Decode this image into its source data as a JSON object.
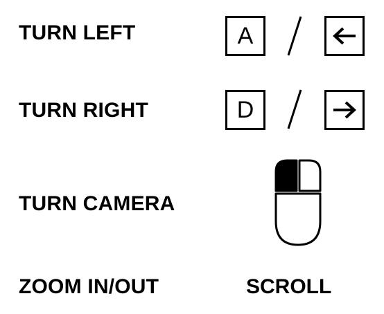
{
  "controls": [
    {
      "action": "TURN LEFT",
      "keys": [
        "A",
        "left-arrow-icon"
      ],
      "separator": "/"
    },
    {
      "action": "TURN RIGHT",
      "keys": [
        "D",
        "right-arrow-icon"
      ],
      "separator": "/"
    },
    {
      "action": "TURN CAMERA",
      "input": "mouse-left-click-icon"
    },
    {
      "action": "ZOOM IN/OUT",
      "input_label": "SCROLL"
    }
  ],
  "colors": {
    "foreground": "#000000",
    "background": "#ffffff"
  }
}
